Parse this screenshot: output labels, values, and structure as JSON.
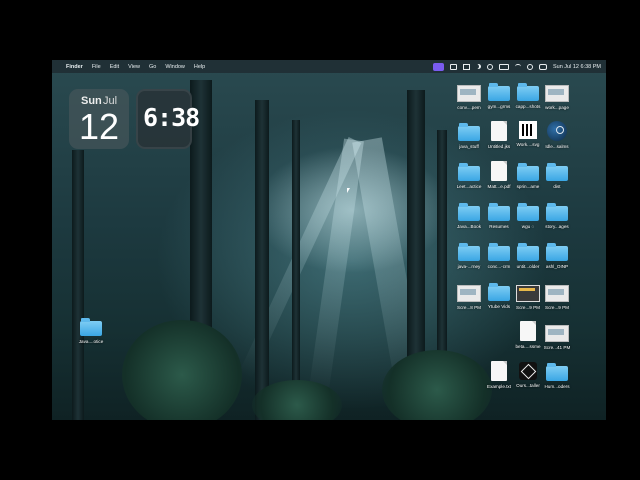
{
  "menubar": {
    "apple_icon": "apple-icon",
    "app_name": "Finder",
    "items": [
      "File",
      "Edit",
      "View",
      "Go",
      "Window",
      "Help"
    ],
    "clock": "Sun Jul 12  6:38 PM"
  },
  "widgets": {
    "date": {
      "weekday": "Sun",
      "month": "Jul",
      "day": "12"
    },
    "clock": {
      "time": "6:38"
    }
  },
  "desktop_icons": {
    "col1": [
      {
        "label": "conv....pem",
        "kind": "shot"
      },
      {
        "label": "java_stuff",
        "kind": "folder"
      },
      {
        "label": "Leet...actice",
        "kind": "folder"
      },
      {
        "label": "Java...Book",
        "kind": "folder"
      },
      {
        "label": "java-...rney",
        "kind": "folder"
      },
      {
        "label": "Scre...8 PM",
        "kind": "shot"
      }
    ],
    "col2": [
      {
        "label": "gym...grms",
        "kind": "folder"
      },
      {
        "label": "Untitled.jks",
        "kind": "doc"
      },
      {
        "label": "Matt...e.pdf",
        "kind": "doc"
      },
      {
        "label": "Resumes",
        "kind": "folder"
      },
      {
        "label": "conc...-crm",
        "kind": "folder"
      },
      {
        "label": "Ytube Vids",
        "kind": "folder"
      },
      {
        "label": "Example.txt",
        "kind": "doc"
      }
    ],
    "col3": [
      {
        "label": "capp...shots",
        "kind": "folder"
      },
      {
        "label": "Work....svg",
        "kind": "qr"
      },
      {
        "label": "sprin...ame",
        "kind": "folder"
      },
      {
        "label": "wgu ◌",
        "kind": "folder"
      },
      {
        "label": "untit...older",
        "kind": "folder"
      },
      {
        "label": "Scre...9 PM",
        "kind": "shotdark"
      },
      {
        "label": "beta....ssme",
        "kind": "doc"
      },
      {
        "label": "Ours...taller",
        "kind": "unity"
      }
    ],
    "col4": [
      {
        "label": "work...page",
        "kind": "shot"
      },
      {
        "label": "Idle...salms",
        "kind": "steam"
      },
      {
        "label": "dist",
        "kind": "folder"
      },
      {
        "label": "story...ages",
        "kind": "folder"
      },
      {
        "label": "ashl_OINP",
        "kind": "folder"
      },
      {
        "label": "Scre...9 PM",
        "kind": "shot"
      },
      {
        "label": "Scre...41 PM",
        "kind": "shot"
      },
      {
        "label": "Hum...oders",
        "kind": "folder"
      }
    ],
    "left_folder": {
      "label": "Java....otice",
      "kind": "folder"
    }
  }
}
